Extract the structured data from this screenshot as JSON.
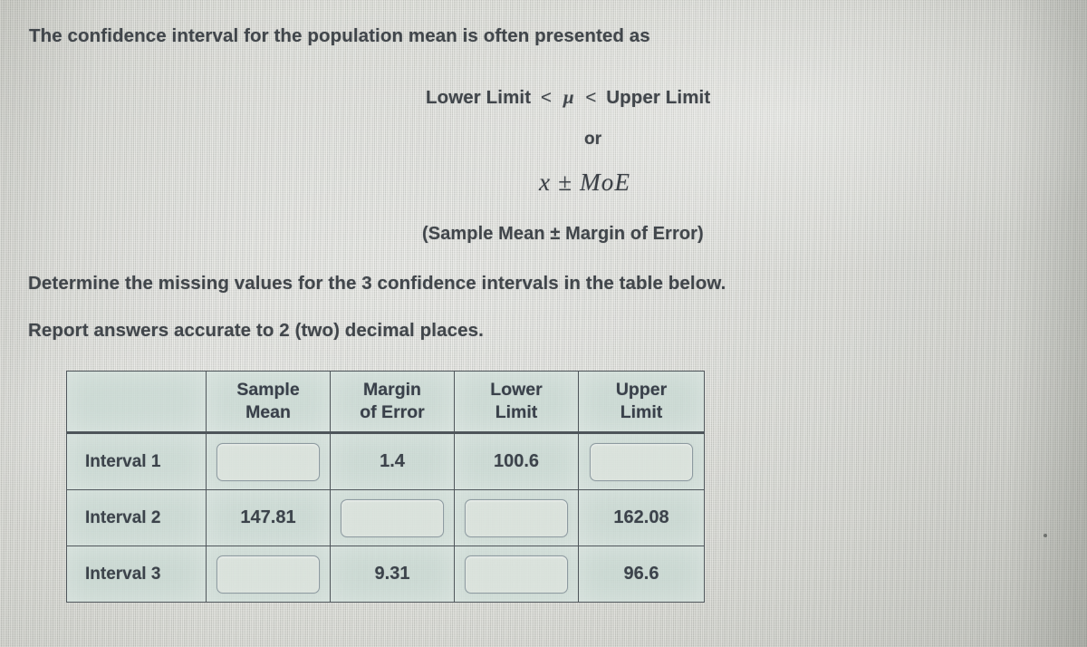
{
  "question": {
    "prompt": "The confidence interval for the population mean is often presented as",
    "inequality": {
      "lower_label": "Lower Limit",
      "relation_left": "<",
      "symbol": "μ",
      "relation_right": "<",
      "upper_label": "Upper Limit"
    },
    "connector": "or",
    "formula": "x ± MoE",
    "formula_expansion": "(Sample Mean ± Margin of Error)",
    "instruction_1": "Determine the missing values for the 3 confidence intervals in the table below.",
    "instruction_2": "Report answers accurate to 2 (two) decimal places."
  },
  "table": {
    "corner_header": "",
    "headers": [
      "Sample\nMean",
      "Margin\nof Error",
      "Lower\nLimit",
      "Upper\nLimit"
    ],
    "headers_split": [
      {
        "line1": "Sample",
        "line2": "Mean"
      },
      {
        "line1": "Margin",
        "line2": "of Error"
      },
      {
        "line1": "Lower",
        "line2": "Limit"
      },
      {
        "line1": "Upper",
        "line2": "Limit"
      }
    ],
    "rows": [
      {
        "label": "Interval 1",
        "sample_mean": "",
        "margin_of_error": "1.4",
        "lower_limit": "100.6",
        "upper_limit": ""
      },
      {
        "label": "Interval 2",
        "sample_mean": "147.81",
        "margin_of_error": "",
        "lower_limit": "",
        "upper_limit": "162.08"
      },
      {
        "label": "Interval 3",
        "sample_mean": "",
        "margin_of_error": "9.31",
        "lower_limit": "",
        "upper_limit": "96.6"
      }
    ]
  },
  "colors": {
    "page_background": "#ddded8",
    "table_tint": "#c8dad3",
    "text": "#41464b",
    "border": "#4e555a",
    "input_border": "#8d9aa0",
    "input_fill": "#e2e7e0"
  }
}
